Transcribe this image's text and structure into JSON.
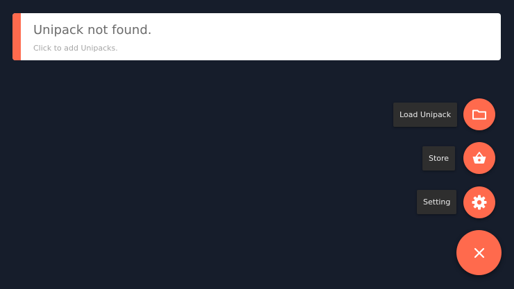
{
  "card": {
    "title": "Unipack not found.",
    "subtitle": "Click to add Unipacks."
  },
  "fab_menu": {
    "items": [
      {
        "label": "Load Unipack",
        "icon": "folder-icon"
      },
      {
        "label": "Store",
        "icon": "basket-icon"
      },
      {
        "label": "Setting",
        "icon": "gear-icon"
      }
    ],
    "main_icon": "close-icon"
  },
  "colors": {
    "background": "#161d2b",
    "accent": "#ff6a4d",
    "card": "#ffffff",
    "label_bg": "#2e2e2e"
  }
}
